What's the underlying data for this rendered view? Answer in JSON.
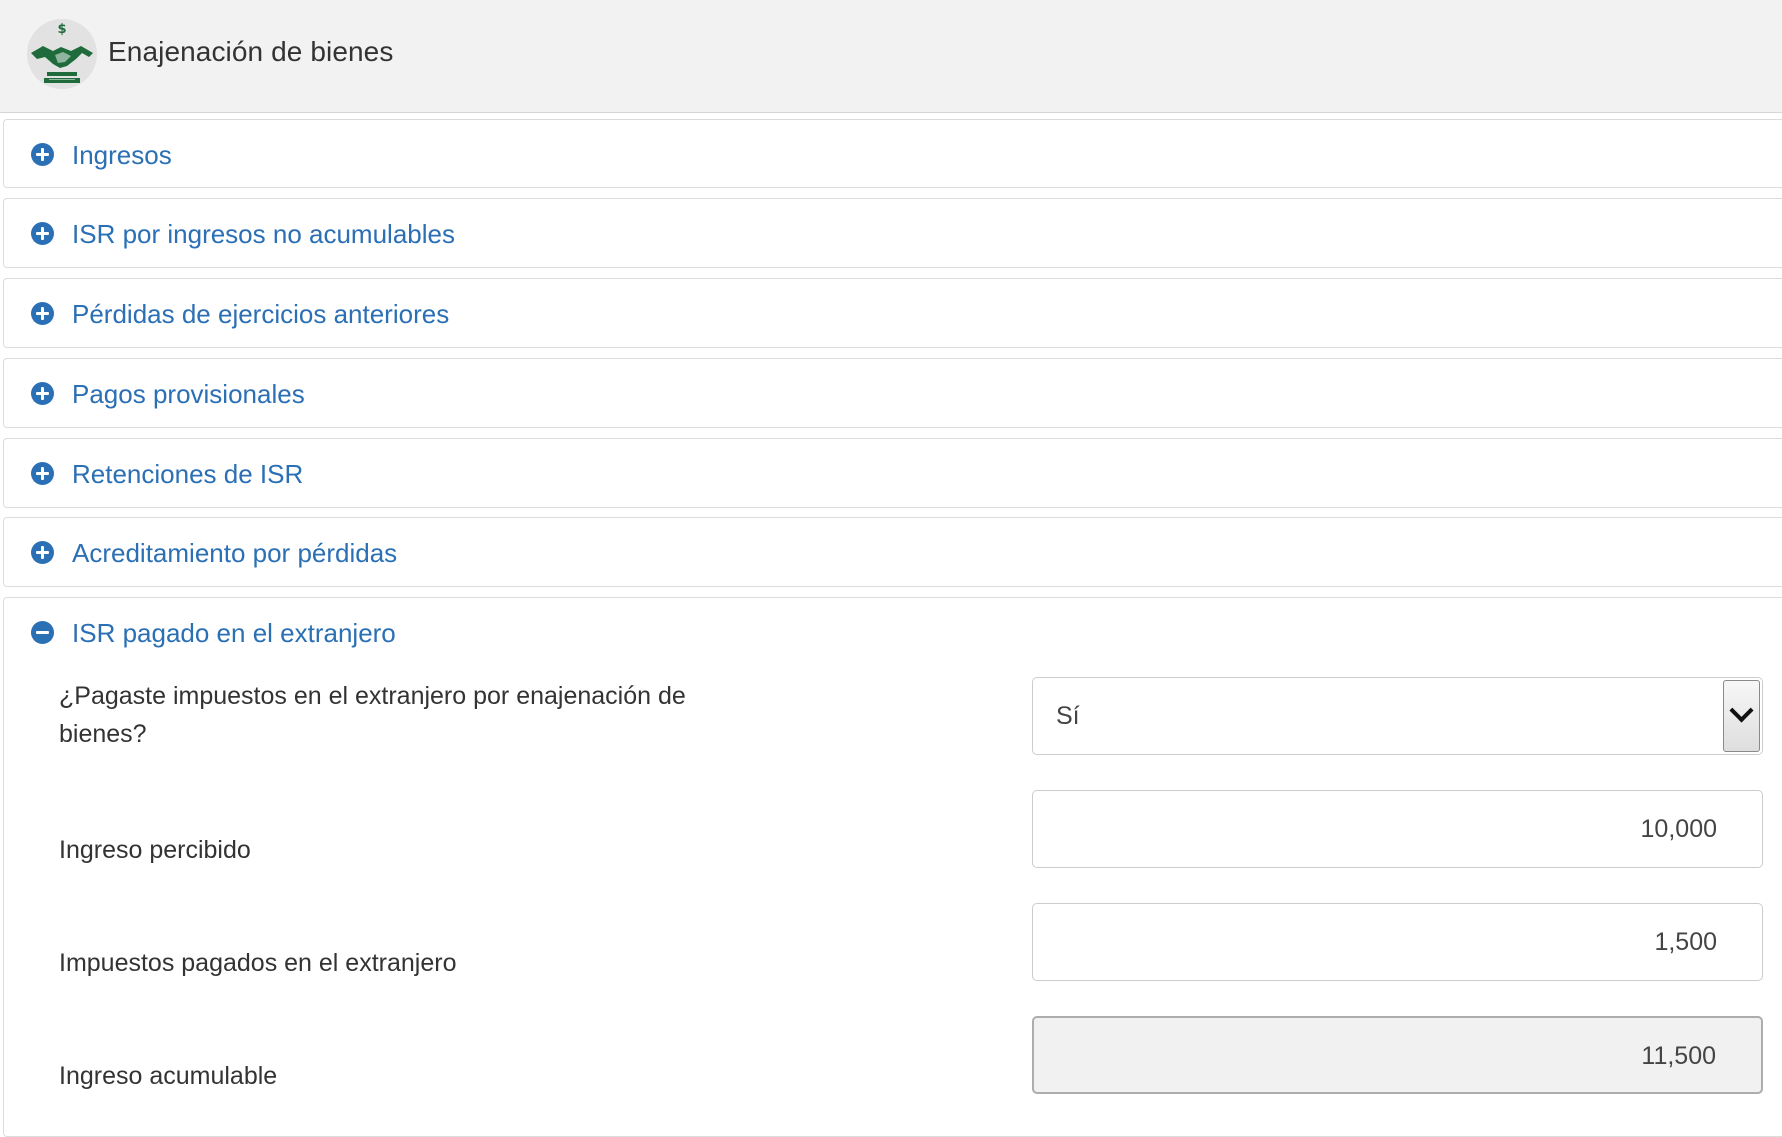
{
  "header": {
    "title": "Enajenación de bienes",
    "logo_icon": "handshake-money-icon"
  },
  "colors": {
    "accent": "#2b6fb4",
    "logo_green": "#1f6b3c",
    "header_bg": "#f2f2f2"
  },
  "sections": [
    {
      "title": "Ingresos",
      "expanded": false
    },
    {
      "title": "ISR por ingresos no acumulables",
      "expanded": false
    },
    {
      "title": "Pérdidas de ejercicios anteriores",
      "expanded": false
    },
    {
      "title": "Pagos provisionales",
      "expanded": false
    },
    {
      "title": "Retenciones de ISR",
      "expanded": false
    },
    {
      "title": "Acreditamiento por pérdidas",
      "expanded": false
    },
    {
      "title": "ISR pagado en el extranjero",
      "expanded": true
    }
  ],
  "foreign_tax": {
    "question_label": "¿Pagaste impuestos en el extranjero por enajenación de bienes?",
    "question_value": "Sí",
    "income_label": "Ingreso percibido",
    "income_value": "10,000",
    "taxes_label": "Impuestos pagados en el extranjero",
    "taxes_value": "1,500",
    "accumulable_label": "Ingreso acumulable",
    "accumulable_value": "11,500"
  }
}
